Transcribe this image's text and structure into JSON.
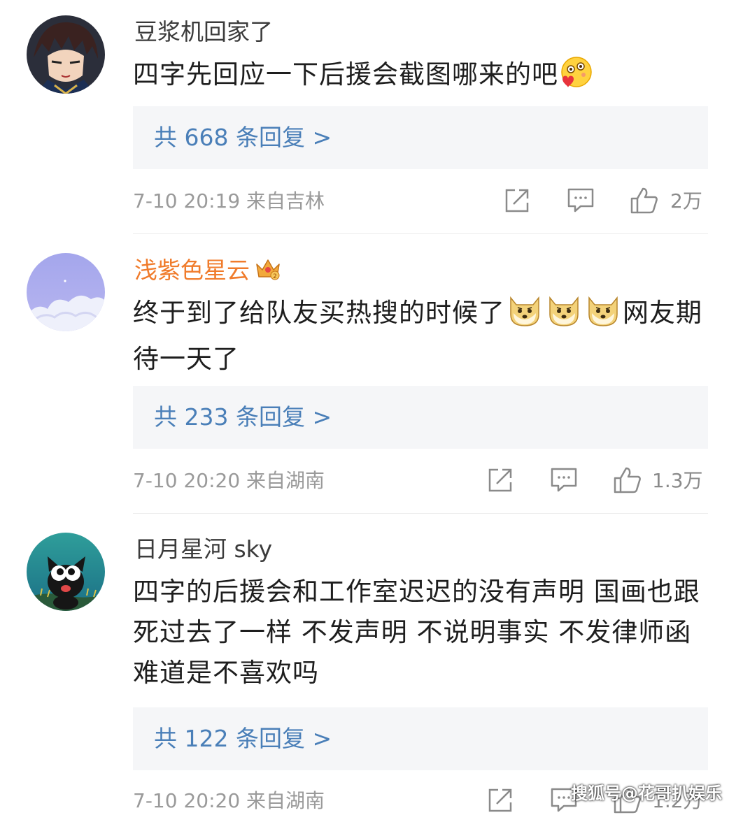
{
  "comments": [
    {
      "username": "豆浆机回家了",
      "text": "四字先回应一下后援会截图哪来的吧",
      "emoji_name": "blush-heart-emoji",
      "replies": "共 668 条回复 >",
      "time": "7-10 20:19",
      "location": "来自吉林",
      "likes": "2万"
    },
    {
      "username": "浅紫色星云",
      "badge": "vip-crown-badge",
      "text_a": "终于到了给队友买热搜的时候了",
      "text_b": "网友期待一天了",
      "emoji_name": "doge-emoji",
      "replies": "共 233 条回复 >",
      "time": "7-10 20:20",
      "location": "来自湖南",
      "likes": "1.3万"
    },
    {
      "username": "日月星河 sky",
      "text": "四字的后援会和工作室迟迟的没有声明 国画也跟死过去了一样 不发声明 不说明事实 不发律师函难道是不喜欢吗",
      "replies": "共 122 条回复 >",
      "time": "7-10 20:20",
      "location": "来自湖南",
      "likes": "1.2万"
    }
  ],
  "watermark": "搜狐号@花哥扒娱乐",
  "colors": {
    "reply_link": "#4a7fb8",
    "vip_name": "#f07b2b",
    "meta": "#9a9a9a"
  },
  "icons": [
    "share-icon",
    "comment-icon",
    "like-icon"
  ]
}
